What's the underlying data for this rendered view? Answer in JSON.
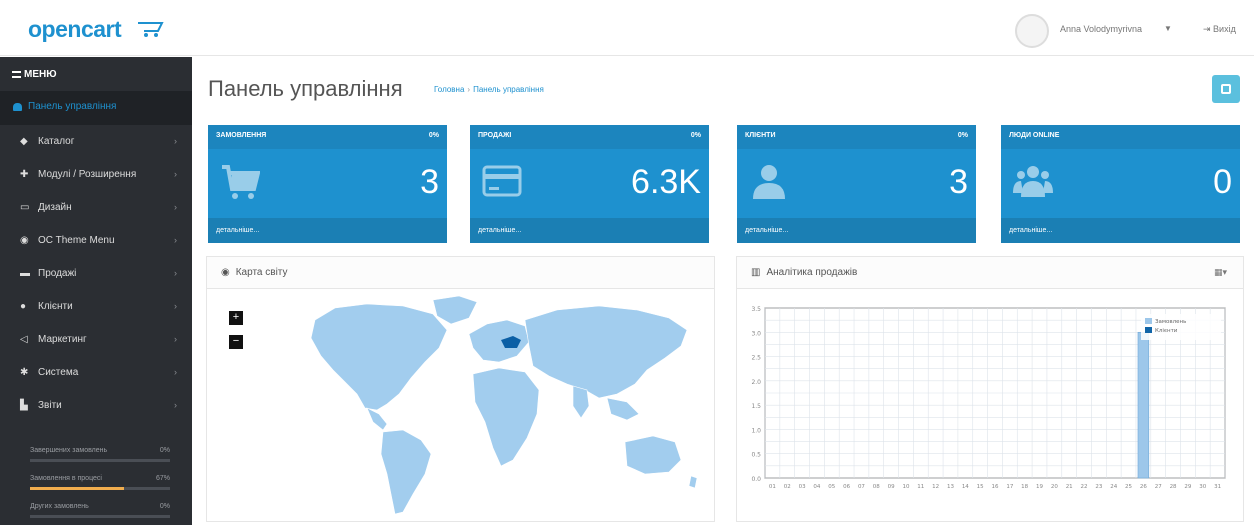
{
  "header": {
    "logo": "opencart",
    "user_name": "Anna Volodymyrivna",
    "logout": "Вихід"
  },
  "sidebar": {
    "menu_title": "МЕНЮ",
    "active_item": "Панель управління",
    "items": [
      {
        "label": "Каталог",
        "icon": "tags-icon"
      },
      {
        "label": "Модулі / Розширення",
        "icon": "puzzle-icon"
      },
      {
        "label": "Дизайн",
        "icon": "desktop-icon"
      },
      {
        "label": "OC Theme Menu",
        "icon": "circle-icon"
      },
      {
        "label": "Продажі",
        "icon": "cart-icon"
      },
      {
        "label": "Клієнти",
        "icon": "user-icon"
      },
      {
        "label": "Маркетинг",
        "icon": "share-icon"
      },
      {
        "label": "Система",
        "icon": "cog-icon"
      },
      {
        "label": "Звіти",
        "icon": "bar-chart-icon"
      }
    ],
    "stats": [
      {
        "label": "Завершених замовлень",
        "percent": "0%",
        "fill": 0,
        "color": "#4a4e55"
      },
      {
        "label": "Замовлення в процесі",
        "percent": "67%",
        "fill": 0.67,
        "color": "#f0ad4e"
      },
      {
        "label": "Других замовлень",
        "percent": "0%",
        "fill": 0,
        "color": "#4a4e55"
      }
    ]
  },
  "main": {
    "title": "Панель управління",
    "breadcrumb": [
      "Головна",
      "Панель управління"
    ]
  },
  "tiles": [
    {
      "title": "ЗАМОВЛЕННЯ",
      "percent": "0%",
      "value": "3",
      "footer": "детальніше...",
      "icon": "cart-icon"
    },
    {
      "title": "ПРОДАЖІ",
      "percent": "0%",
      "value": "6.3K",
      "footer": "детальніше...",
      "icon": "credit-card-icon"
    },
    {
      "title": "КЛІЄНТИ",
      "percent": "0%",
      "value": "3",
      "footer": "детальніше...",
      "icon": "user-icon"
    },
    {
      "title": "ЛЮДИ ONLINE",
      "percent": "",
      "value": "0",
      "footer": "детальніше...",
      "icon": "users-icon"
    }
  ],
  "map_panel": {
    "title": "Карта світу",
    "zoom_in": "+",
    "zoom_out": "−"
  },
  "chart_panel": {
    "title": "Аналітика продажів"
  },
  "chart_data": {
    "type": "bar",
    "categories": [
      "01",
      "02",
      "03",
      "04",
      "05",
      "06",
      "07",
      "08",
      "09",
      "10",
      "11",
      "12",
      "13",
      "14",
      "15",
      "16",
      "17",
      "18",
      "19",
      "20",
      "21",
      "22",
      "23",
      "24",
      "25",
      "26",
      "27",
      "28",
      "29",
      "30",
      "31"
    ],
    "series": [
      {
        "name": "Замовлень",
        "values": [
          0,
          0,
          0,
          0,
          0,
          0,
          0,
          0,
          0,
          0,
          0,
          0,
          0,
          0,
          0,
          0,
          0,
          0,
          0,
          0,
          0,
          0,
          0,
          0,
          0,
          3,
          0,
          0,
          0,
          0,
          0
        ],
        "color": "#9dc7ea"
      },
      {
        "name": "Клієнти",
        "values": [
          0,
          0,
          0,
          0,
          0,
          0,
          0,
          0,
          0,
          0,
          0,
          0,
          0,
          0,
          0,
          0,
          0,
          0,
          0,
          0,
          0,
          0,
          0,
          0,
          0,
          0,
          0,
          0,
          0,
          0,
          0
        ],
        "color": "#1065a8"
      }
    ],
    "yticks": [
      "0.0",
      "0.5",
      "1.0",
      "1.5",
      "2.0",
      "2.5",
      "3.0",
      "3.5"
    ],
    "ylim": [
      0,
      3.5
    ],
    "grid": true,
    "legend_position": "top-right"
  },
  "colors": {
    "accent": "#1e91cf",
    "sidebar": "#2b2e33",
    "map_land": "#a2cdee",
    "map_highlight": "#0b5fa5"
  }
}
